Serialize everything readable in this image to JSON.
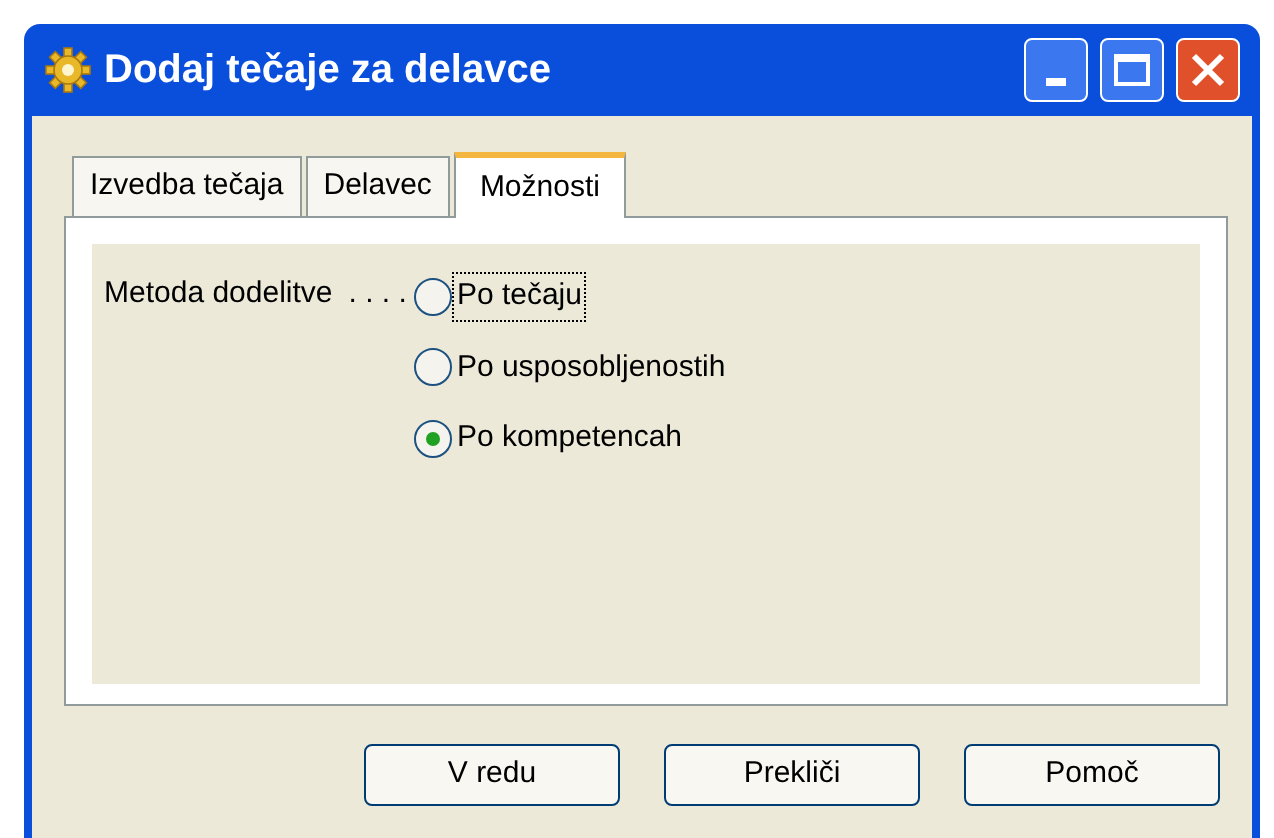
{
  "window": {
    "title": "Dodaj tečaje za delavce"
  },
  "tabs": [
    {
      "label": "Izvedba tečaja",
      "selected": false
    },
    {
      "label": "Delavec",
      "selected": false
    },
    {
      "label": "Možnosti",
      "selected": true
    }
  ],
  "field": {
    "label": "Metoda dodelitve",
    "leader": ". . . .",
    "options": [
      {
        "label": "Po tečaju",
        "selected": false,
        "focused": true
      },
      {
        "label": "Po usposobljenostih",
        "selected": false,
        "focused": false
      },
      {
        "label": "Po kompetencah",
        "selected": true,
        "focused": false
      }
    ]
  },
  "buttons": [
    "V redu",
    "Prekliči",
    "Pomoč"
  ]
}
